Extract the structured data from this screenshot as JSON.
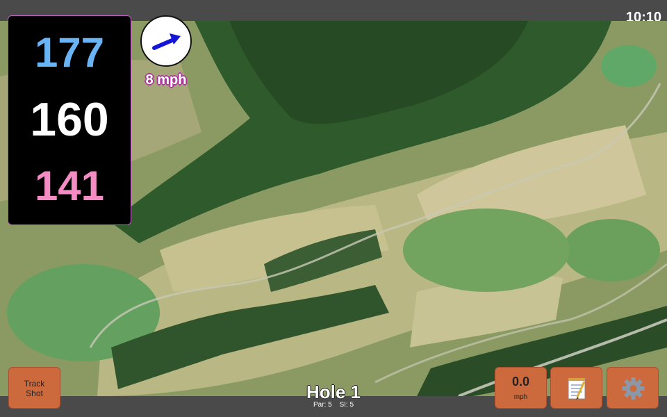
{
  "status": {
    "time": "10:10"
  },
  "distances": {
    "back": "177",
    "middle": "160",
    "front": "141"
  },
  "wind": {
    "speed_label": "8 mph",
    "direction_icon": "wind-arrow-icon"
  },
  "buttons": {
    "track_shot_line1": "Track",
    "track_shot_line2": "Shot",
    "wind_value": "0.0",
    "wind_unit": "mph",
    "notes_icon": "notepad-icon",
    "settings_icon": "gear-icon"
  },
  "hole": {
    "title": "Hole 1",
    "par_label": "Par: 5",
    "si_label": "SI: 5"
  },
  "colors": {
    "back_distance": "#6ab4f5",
    "middle_distance": "#ffffff",
    "front_distance": "#f48cc4",
    "button": "#cd6a3d",
    "wind_arrow": "#1515d8"
  }
}
